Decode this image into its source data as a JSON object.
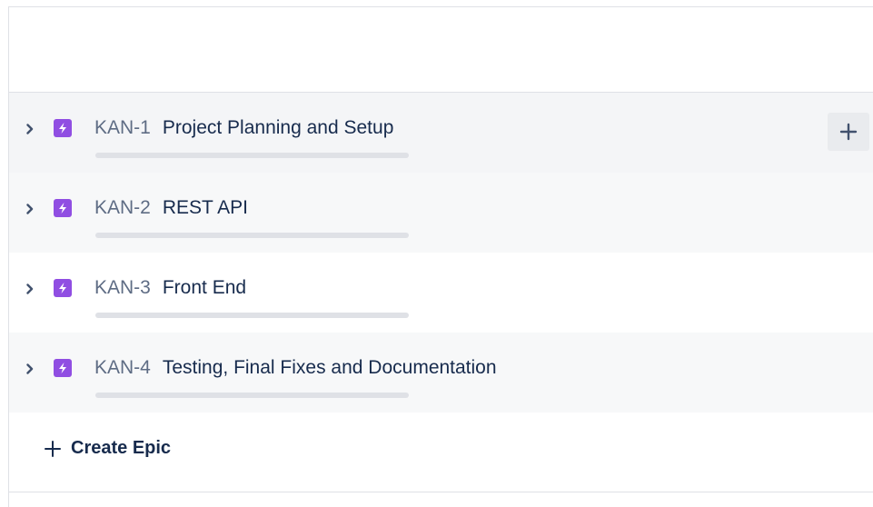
{
  "epics": [
    {
      "key": "KAN-1",
      "title": "Project Planning and Setup",
      "progress_fraction": 0
    },
    {
      "key": "KAN-2",
      "title": "REST API",
      "progress_fraction": 0
    },
    {
      "key": "KAN-3",
      "title": "Front End",
      "progress_fraction": 0
    },
    {
      "key": "KAN-4",
      "title": "Testing, Final Fixes and Documentation",
      "progress_fraction": 0
    }
  ],
  "create_epic": {
    "label": "Create Epic"
  },
  "icons": {
    "expand": "chevron-right-icon",
    "epic": "epic-lightning-icon",
    "add": "plus-icon"
  },
  "colors": {
    "epic_icon": "#904ee2",
    "progress_track": "#dfe1e6",
    "text_primary": "#172b4d",
    "text_key": "#5e6c84"
  }
}
